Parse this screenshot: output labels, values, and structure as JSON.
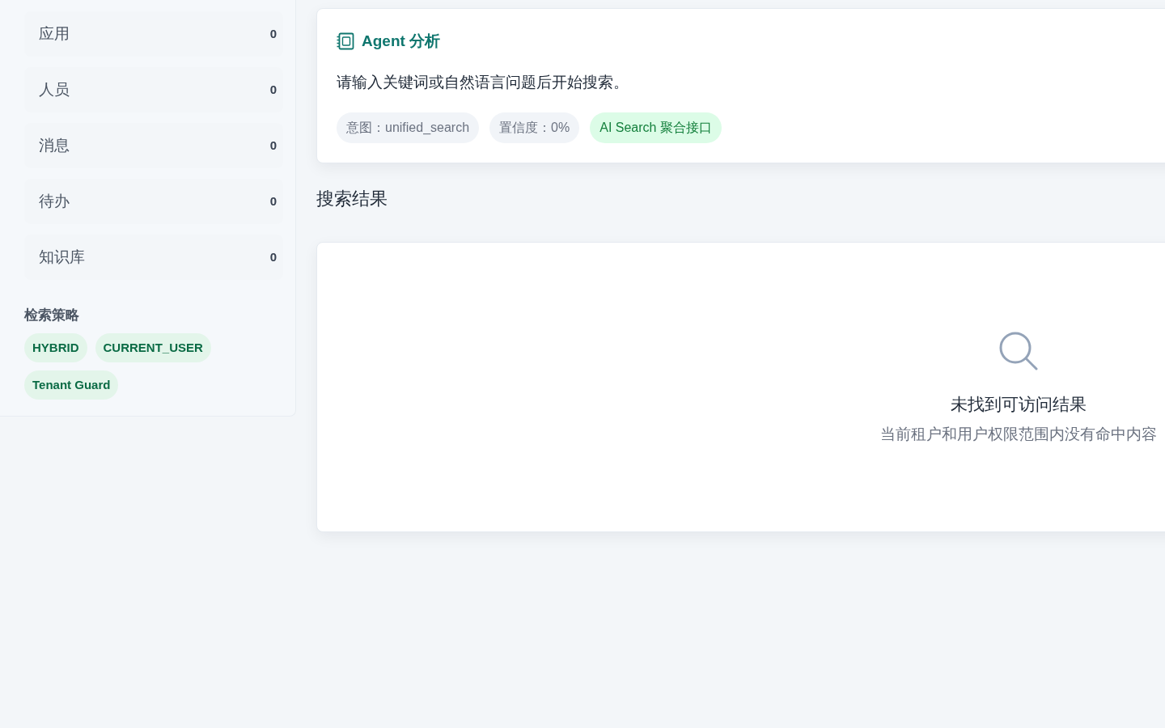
{
  "sidebar": {
    "items": [
      {
        "label": "应用",
        "count": "0"
      },
      {
        "label": "人员",
        "count": "0"
      },
      {
        "label": "消息",
        "count": "0"
      },
      {
        "label": "待办",
        "count": "0"
      },
      {
        "label": "知识库",
        "count": "0"
      }
    ],
    "strategy": {
      "title": "检索策略",
      "tags": [
        "HYBRID",
        "CURRENT_USER",
        "Tenant Guard"
      ]
    }
  },
  "agent_card": {
    "title": "Agent 分析",
    "message": "请输入关键词或自然语言问题后开始搜索。",
    "chips": [
      {
        "text": "意图：unified_search",
        "kind": "neutral"
      },
      {
        "text": "置信度：0%",
        "kind": "neutral"
      },
      {
        "text": "AI Search 聚合接口",
        "kind": "source"
      }
    ]
  },
  "results": {
    "heading": "搜索结果",
    "empty_state": {
      "title": "未找到可访问结果",
      "message": "当前租户和用户权限范围内没有命中内容"
    }
  }
}
